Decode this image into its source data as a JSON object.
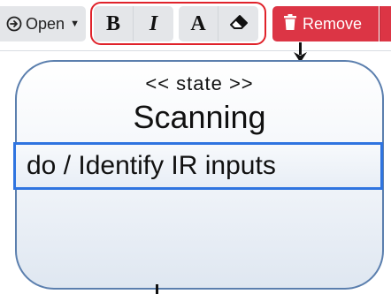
{
  "toolbar": {
    "open_label": "Open",
    "format_buttons": {
      "bold": "B",
      "italic": "I",
      "font_color": "A"
    },
    "remove_label": "Remove",
    "highlight_color": "#e0222a",
    "remove_color": "#dc3545"
  },
  "diagram": {
    "state": {
      "stereotype": "<< state >>",
      "name": "Scanning",
      "activity": "do / Identify IR inputs"
    },
    "border_color": "#5b7fae",
    "selection_color": "#2f74e0"
  }
}
